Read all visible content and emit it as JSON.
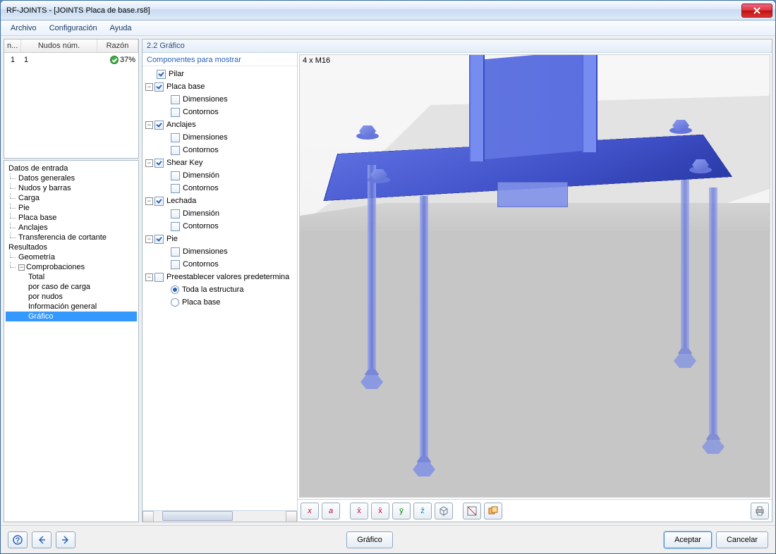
{
  "window": {
    "title": "RF-JOINTS - [JOINTS Placa de base.rs8]"
  },
  "menu": {
    "file": "Archivo",
    "config": "Configuración",
    "help": "Ayuda"
  },
  "grid": {
    "col_n": "n...",
    "col_nodes": "Nudos núm.",
    "col_reason": "Razón",
    "rows": [
      {
        "n": "1",
        "nodes": "1",
        "ratio": "37%"
      }
    ]
  },
  "nav": {
    "input_header": "Datos de entrada",
    "items_in": [
      "Datos generales",
      "Nudos y barras",
      "Carga",
      "Pie",
      "Placa base",
      "Anclajes",
      "Transferencia de cortante"
    ],
    "results_header": "Resultados",
    "geometria": "Geometría",
    "comprobaciones": "Comprobaciones",
    "items_check": [
      "Total",
      "por caso de carga",
      "por nudos",
      "Información general"
    ],
    "grafico": "Gráfico"
  },
  "panel": {
    "title": "2.2 Gráfico",
    "comp_title": "Componentes para mostrar"
  },
  "tree": {
    "pilar": "Pilar",
    "placa": "Placa base",
    "dim": "Dimensiones",
    "cont": "Contornos",
    "anclajes": "Anclajes",
    "shearkey": "Shear Key",
    "dim1": "Dimensión",
    "lechada": "Lechada",
    "pie": "Pie",
    "preset": "Preestablecer valores predetermina",
    "opt_whole": "Toda la estructura",
    "opt_plate": "Placa base"
  },
  "gfx": {
    "label": "4 x M16"
  },
  "footer": {
    "grafico": "Gráfico",
    "aceptar": "Aceptar",
    "cancelar": "Cancelar"
  },
  "toolbar_icons": [
    "x",
    "a",
    "x̄",
    "x̄",
    "ȳ",
    "z̄",
    "□",
    "✂",
    "⧉",
    "⎙"
  ]
}
